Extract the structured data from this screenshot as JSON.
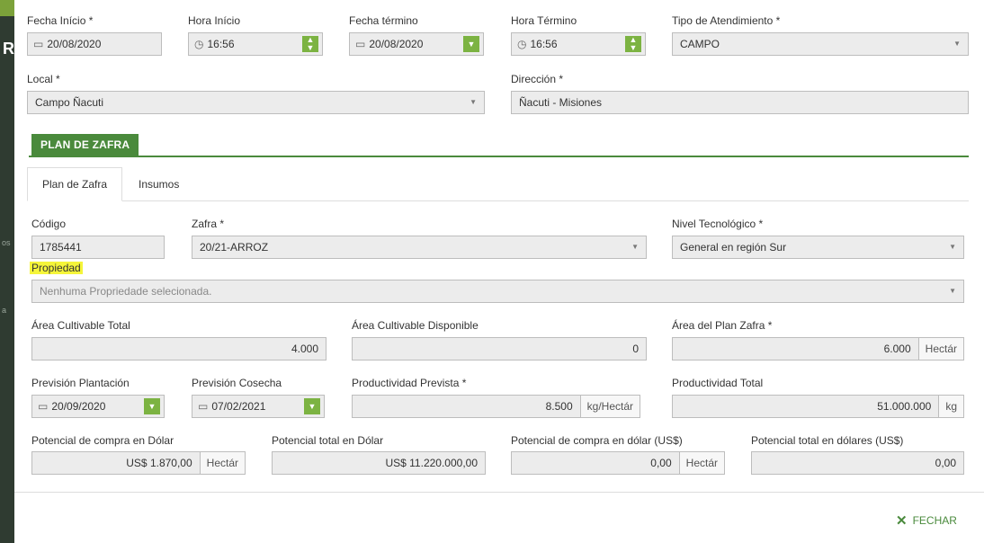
{
  "background_fragments": {
    "letter": "R",
    "frag_a": "os",
    "frag_b": "a"
  },
  "top": {
    "fecha_inicio": {
      "label": "Fecha Início *",
      "value": "20/08/2020"
    },
    "hora_inicio": {
      "label": "Hora Início",
      "value": "16:56"
    },
    "fecha_termino": {
      "label": "Fecha término",
      "value": "20/08/2020"
    },
    "hora_termino": {
      "label": "Hora Término",
      "value": "16:56"
    },
    "tipo_atendimiento": {
      "label": "Tipo de Atendimiento *",
      "value": "CAMPO"
    },
    "local": {
      "label": "Local *",
      "value": "Campo Ñacuti"
    },
    "direccion": {
      "label": "Dirección *",
      "value": "Ñacuti - Misiones"
    }
  },
  "section": {
    "title": "PLAN DE ZAFRA"
  },
  "tabs": [
    {
      "label": "Plan de Zafra",
      "active": true
    },
    {
      "label": "Insumos",
      "active": false
    }
  ],
  "plan": {
    "codigo": {
      "label": "Código",
      "value": "1785441"
    },
    "zafra": {
      "label": "Zafra *",
      "value": "20/21-ARROZ"
    },
    "nivel": {
      "label": "Nivel Tecnológico *",
      "value": "General en región Sur"
    },
    "propiedad": {
      "label": "Propiedad",
      "placeholder": "Nenhuma Propriedade selecionada."
    },
    "area_total": {
      "label": "Área Cultivable Total",
      "value": "4.000"
    },
    "area_disponible": {
      "label": "Área Cultivable Disponible",
      "value": "0"
    },
    "area_plan": {
      "label": "Área del Plan Zafra *",
      "value": "6.000",
      "unit": "Hectár"
    },
    "prev_plantacion": {
      "label": "Previsión Plantación",
      "value": "20/09/2020"
    },
    "prev_cosecha": {
      "label": "Previsión Cosecha",
      "value": "07/02/2021"
    },
    "productividad_prevista": {
      "label": "Productividad Prevista *",
      "value": "8.500",
      "unit": "kg/Hectár"
    },
    "productividad_total": {
      "label": "Productividad Total",
      "value": "51.000.000",
      "unit": "kg"
    },
    "potencial_compra_dolar": {
      "label": "Potencial de compra en Dólar",
      "value": "US$  1.870,00",
      "unit": "Hectár"
    },
    "potencial_total_dolar": {
      "label": "Potencial total en Dólar",
      "value": "US$  11.220.000,00"
    },
    "potencial_compra_usd": {
      "label": "Potencial de compra en dólar (US$)",
      "value": "0,00",
      "unit": "Hectár"
    },
    "potencial_total_usd": {
      "label": "Potencial total en dólares (US$)",
      "value": "0,00"
    }
  },
  "footer": {
    "close_label": "FECHAR"
  },
  "colors": {
    "accent": "#4a8a3c",
    "button_green": "#7cb342",
    "highlight": "#f5f53a"
  }
}
